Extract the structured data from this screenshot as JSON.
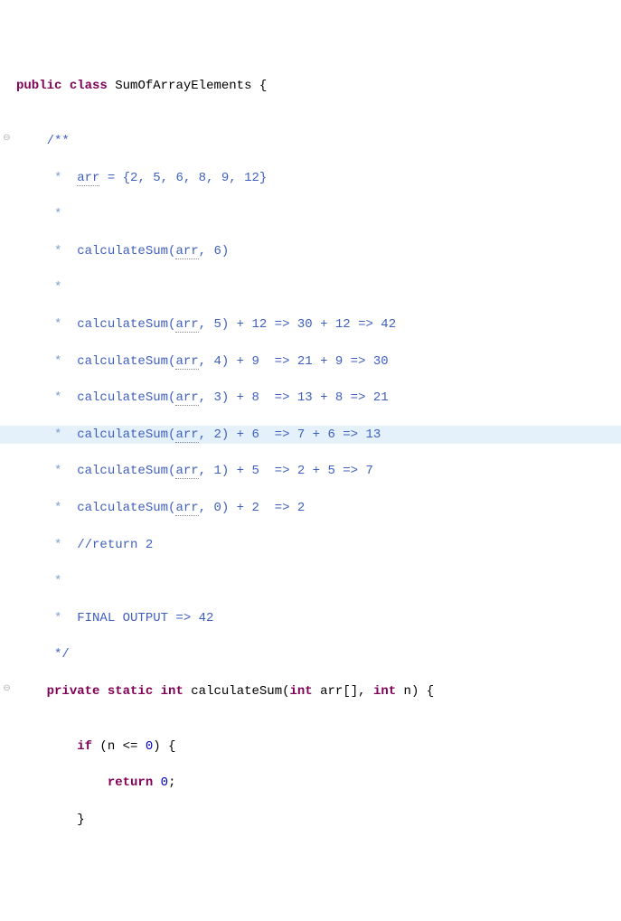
{
  "line01": {
    "kw_public": "public",
    "kw_class": "class",
    "classname": "SumOfArrayElements",
    "brace": "{"
  },
  "line02": "",
  "line03": {
    "open": "/**"
  },
  "line04": {
    "ast": " *  ",
    "ident": "arr",
    "rest": " = {2, 5, 6, 8, 9, 12}"
  },
  "line05": {
    "ast": " *  "
  },
  "line06": {
    "ast": " *  ",
    "t1": "calculateSum(",
    "ident": "arr",
    "t2": ", 6)"
  },
  "line07": {
    "ast": " *  "
  },
  "line08": {
    "ast": " *  ",
    "t1": "calculateSum(",
    "ident": "arr",
    "t2": ", 5) + 12 => 30 + 12 => 42"
  },
  "line09": {
    "ast": " *  ",
    "t1": "calculateSum(",
    "ident": "arr",
    "t2": ", 4) + 9  => 21 + 9 => 30"
  },
  "line10": {
    "ast": " *  ",
    "t1": "calculateSum(",
    "ident": "arr",
    "t2": ", 3) + 8  => 13 + 8 => 21"
  },
  "line11": {
    "ast": " *  ",
    "t1": "calculateSum(",
    "ident": "arr",
    "t2": ", 2) + 6  => 7 + 6 => 13"
  },
  "line12": {
    "ast": " *  ",
    "t1": "calculateSum(",
    "ident": "arr",
    "t2": ", 1) + 5  => 2 + 5 => 7"
  },
  "line13": {
    "ast": " *  ",
    "t1": "calculateSum(",
    "ident": "arr",
    "t2": ", 0) + 2  => 2"
  },
  "line14": {
    "ast": " *  ",
    "t1": "//return 2"
  },
  "line15": {
    "ast": " *  "
  },
  "line16": {
    "ast": " *  ",
    "t1": "FINAL OUTPUT => 42"
  },
  "line17": {
    "close": " */"
  },
  "line18": {
    "kw_private": "private",
    "kw_static": "static",
    "kw_int": "int",
    "fn": "calculateSum(",
    "kw_int2": "int",
    "p1": " arr[], ",
    "kw_int3": "int",
    "p2": " n) {"
  },
  "line19": "",
  "line20": {
    "kw_if": "if",
    "cond1": " (n <= ",
    "zero": "0",
    "cond2": ") {"
  },
  "line21": {
    "kw_return": "return",
    "sp": " ",
    "zero": "0",
    "semi": ";"
  },
  "line22": {
    "brace": "}"
  }
}
